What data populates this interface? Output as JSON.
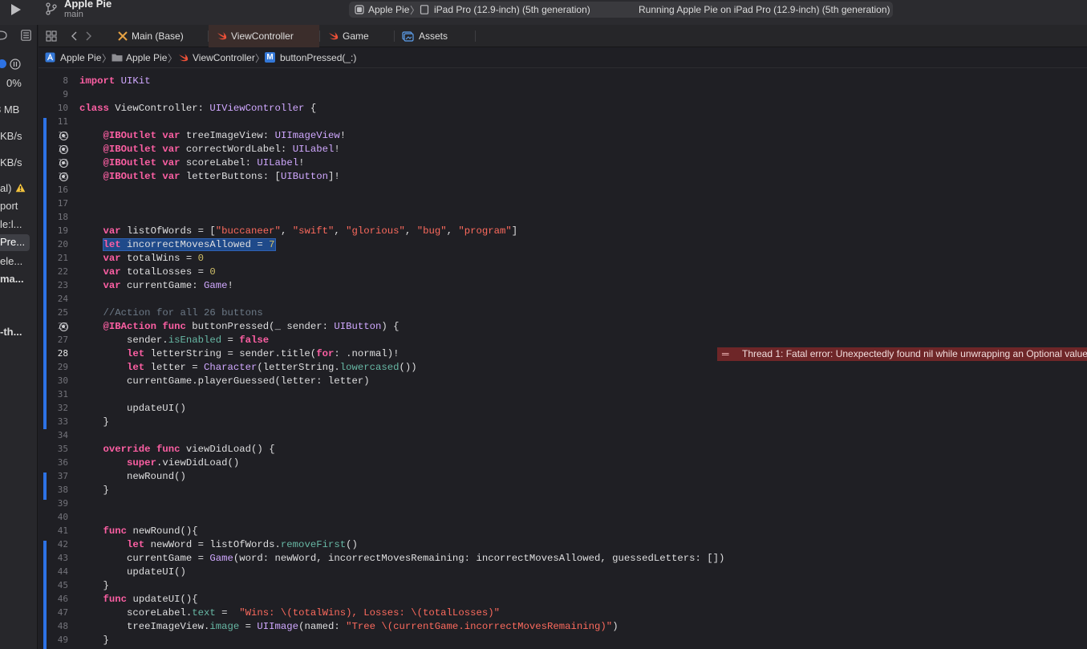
{
  "titlebar": {
    "project_name": "Apple Pie",
    "branch": "main",
    "scheme": "Apple Pie",
    "scheme_separator": "〉",
    "device": "iPad Pro (12.9-inch) (5th generation)",
    "status": "Running Apple Pie on iPad Pro (12.9-inch) (5th generation)"
  },
  "left_panel": {
    "cpu": "0%",
    "memory": "8 MB",
    "disk": "KB/s",
    "network": "KB/s",
    "item1": "al)",
    "item2": "port",
    "item3": "le:l...",
    "item4": "Pre...",
    "item5": "ele...",
    "item6": "ma...",
    "item7": "-th..."
  },
  "tabs": [
    {
      "label": "Main (Base)",
      "icon": "interface-builder-icon"
    },
    {
      "label": "ViewController",
      "icon": "swift-icon"
    },
    {
      "label": "Game",
      "icon": "swift-icon"
    },
    {
      "label": "Assets",
      "icon": "asset-catalog-icon"
    }
  ],
  "jumpbar": {
    "project": "Apple Pie",
    "folder": "Apple Pie",
    "file": "ViewController",
    "symbol_badge": "M",
    "symbol": "buttonPressed(_:)",
    "separator": "〉"
  },
  "error": {
    "message": "Thread 1: Fatal error: Unexpectedly found nil while unwrapping an Optional value"
  },
  "code_lines": [
    {
      "n": "8",
      "t": "import UIKit"
    },
    {
      "n": "9",
      "t": ""
    },
    {
      "n": "10",
      "t": "class ViewController: UIViewController {"
    },
    {
      "n": "11",
      "t": ""
    },
    {
      "n": "12",
      "t": "    @IBOutlet var treeImageView: UIImageView!"
    },
    {
      "n": "13",
      "t": "    @IBOutlet var correctWordLabel: UILabel!"
    },
    {
      "n": "14",
      "t": "    @IBOutlet var scoreLabel: UILabel!"
    },
    {
      "n": "15",
      "t": "    @IBOutlet var letterButtons: [UIButton]!"
    },
    {
      "n": "16",
      "t": ""
    },
    {
      "n": "17",
      "t": ""
    },
    {
      "n": "18",
      "t": ""
    },
    {
      "n": "19",
      "t": "    var listOfWords = [\"buccaneer\", \"swift\", \"glorious\", \"bug\", \"program\"]"
    },
    {
      "n": "20",
      "t": "    let incorrectMovesAllowed = 7"
    },
    {
      "n": "21",
      "t": "    var totalWins = 0"
    },
    {
      "n": "22",
      "t": "    var totalLosses = 0"
    },
    {
      "n": "23",
      "t": "    var currentGame: Game!"
    },
    {
      "n": "24",
      "t": ""
    },
    {
      "n": "25",
      "t": "    //Action for all 26 buttons"
    },
    {
      "n": "26",
      "t": "    @IBAction func buttonPressed(_ sender: UIButton) {"
    },
    {
      "n": "27",
      "t": "        sender.isEnabled = false"
    },
    {
      "n": "28",
      "t": "        let letterString = sender.title(for: .normal)!"
    },
    {
      "n": "29",
      "t": "        let letter = Character(letterString.lowercased())"
    },
    {
      "n": "30",
      "t": "        currentGame.playerGuessed(letter: letter)"
    },
    {
      "n": "31",
      "t": ""
    },
    {
      "n": "32",
      "t": "        updateUI()"
    },
    {
      "n": "33",
      "t": "    }"
    },
    {
      "n": "34",
      "t": ""
    },
    {
      "n": "35",
      "t": "    override func viewDidLoad() {"
    },
    {
      "n": "36",
      "t": "        super.viewDidLoad()"
    },
    {
      "n": "37",
      "t": "        newRound()"
    },
    {
      "n": "38",
      "t": "    }"
    },
    {
      "n": "39",
      "t": ""
    },
    {
      "n": "40",
      "t": ""
    },
    {
      "n": "41",
      "t": "    func newRound(){"
    },
    {
      "n": "42",
      "t": "        let newWord = listOfWords.removeFirst()"
    },
    {
      "n": "43",
      "t": "        currentGame = Game(word: newWord, incorrectMovesRemaining: incorrectMovesAllowed, guessedLetters: [])"
    },
    {
      "n": "44",
      "t": "        updateUI()"
    },
    {
      "n": "45",
      "t": "    }"
    },
    {
      "n": "46",
      "t": "    func updateUI(){"
    },
    {
      "n": "47",
      "t": "        scoreLabel.text =  \"Wins: \\(totalWins), Losses: \\(totalLosses)\""
    },
    {
      "n": "48",
      "t": "        treeImageView.image = UIImage(named: \"Tree \\(currentGame.incorrectMovesRemaining)\")"
    },
    {
      "n": "49",
      "t": "    }"
    }
  ],
  "current_line": "28",
  "breakpoint_lines": [
    "12",
    "13",
    "14",
    "15",
    "26"
  ],
  "colors": {
    "keyword": "#fc5fa3",
    "type": "#d0a8ff",
    "string": "#fc6a5d",
    "number": "#d0bf69",
    "comment": "#6c7986",
    "error_bg": "#6e2628",
    "change_bar": "#2d72e4"
  }
}
